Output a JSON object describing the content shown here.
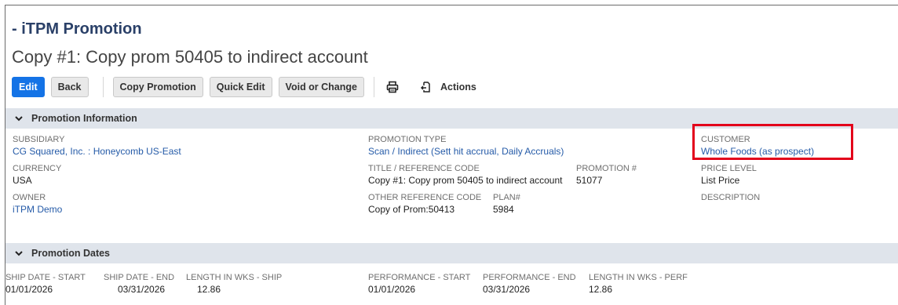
{
  "header": {
    "record_type": "- iTPM Promotion",
    "title": "Copy #1: Copy prom 50405 to indirect account"
  },
  "toolbar": {
    "edit_label": "Edit",
    "back_label": "Back",
    "copy_label": "Copy Promotion",
    "quick_edit_label": "Quick Edit",
    "void_label": "Void or Change",
    "actions_label": "Actions",
    "icons": [
      "print-icon",
      "export-icon"
    ]
  },
  "sections": {
    "info": {
      "title": "Promotion Information",
      "subsidiary_label": "SUBSIDIARY",
      "subsidiary_value": "CG Squared, Inc. : Honeycomb US-East",
      "currency_label": "CURRENCY",
      "currency_value": "USA",
      "owner_label": "OWNER",
      "owner_value": "iTPM Demo",
      "promo_type_label": "PROMOTION TYPE",
      "promo_type_value": "Scan / Indirect (Sett hit accrual, Daily Accruals)",
      "title_ref_label": "TITLE / REFERENCE CODE",
      "title_ref_value": "Copy #1: Copy prom 50405 to indirect account",
      "promo_num_label": "PROMOTION #",
      "promo_num_value": "51077",
      "other_ref_label": "OTHER REFERENCE CODE",
      "other_ref_value": "Copy of Prom:50413",
      "plan_label": "PLAN#",
      "plan_value": "5984",
      "customer_label": "CUSTOMER",
      "customer_value": "Whole Foods (as prospect)",
      "price_level_label": "PRICE LEVEL",
      "price_level_value": "List Price",
      "description_label": "DESCRIPTION"
    },
    "dates": {
      "title": "Promotion Dates",
      "ship_start_label": "SHIP DATE - START",
      "ship_start_value": "01/01/2026",
      "ship_end_label": "SHIP DATE - END",
      "ship_end_value": "03/31/2026",
      "len_ship_label": "LENGTH IN WKS - SHIP",
      "len_ship_value": "12.86",
      "perf_start_label": "PERFORMANCE - START",
      "perf_start_value": "01/01/2026",
      "perf_end_label": "PERFORMANCE - END",
      "perf_end_value": "03/31/2026",
      "len_perf_label": "LENGTH IN WKS - PERF",
      "len_perf_value": "12.86"
    }
  },
  "colors": {
    "primary_button": "#1473e6",
    "record_type_text": "#2a4068",
    "link": "#255ba8",
    "section_bar": "#dfe4eb",
    "highlight": "#e3001b"
  }
}
